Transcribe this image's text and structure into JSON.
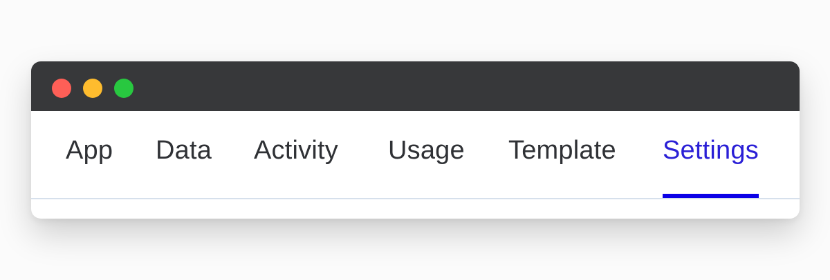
{
  "window": {
    "controls": [
      "close",
      "minimize",
      "maximize"
    ]
  },
  "tabs": [
    {
      "label": "App",
      "active": false
    },
    {
      "label": "Data",
      "active": false
    },
    {
      "label": "Activity",
      "active": false
    },
    {
      "label": "Usage",
      "active": false
    },
    {
      "label": "Template",
      "active": false
    },
    {
      "label": "Settings",
      "active": true
    }
  ],
  "colors": {
    "titlebar": "#37383a",
    "accent": "#0b00e6",
    "active_text": "#2a1fd6",
    "text": "#2f3135",
    "divider": "#d6e0ec"
  }
}
